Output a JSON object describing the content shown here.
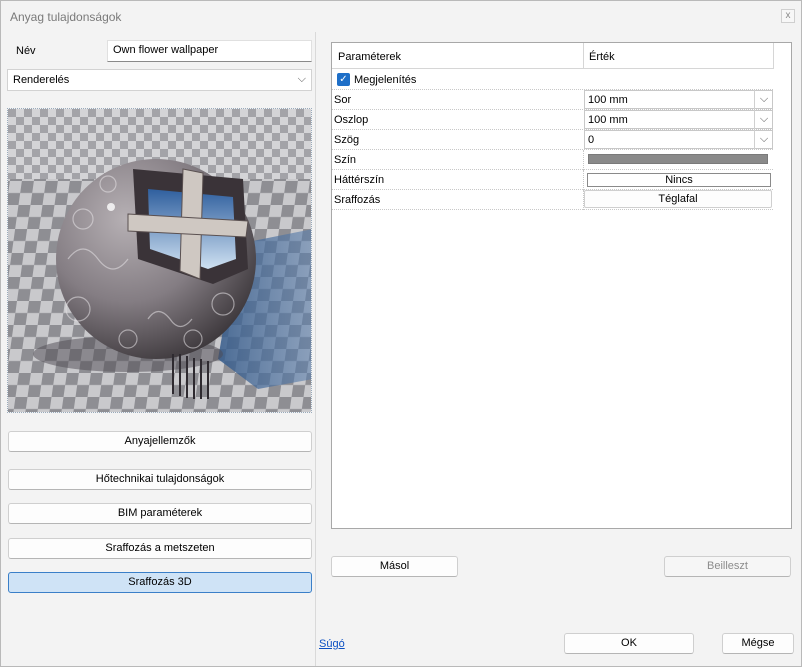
{
  "window": {
    "title": "Anyag tulajdonságok",
    "close_glyph": "x"
  },
  "left": {
    "name_label": "Név",
    "name_value": "Own flower wallpaper",
    "mode_select": "Renderelés",
    "buttons": {
      "material": "Anyajellemzők",
      "thermal": "Hőtechnikai tulajdonságok",
      "bim": "BIM paraméterek",
      "hatch_section": "Sraffozás a metszeten",
      "hatch_3d": "Sraffozás 3D"
    }
  },
  "grid": {
    "col_param": "Paraméterek",
    "col_value": "Érték",
    "group_label": "Megjelenítés",
    "rows": [
      {
        "label": "Sor",
        "value": "100 mm"
      },
      {
        "label": "Oszlop",
        "value": "100 mm"
      },
      {
        "label": "Szög",
        "value": "0"
      },
      {
        "label": "Szín",
        "value": ""
      },
      {
        "label": "Háttérszín",
        "value": "Nincs"
      },
      {
        "label": "Sraffozás",
        "value": "Téglafal"
      }
    ]
  },
  "actions": {
    "copy": "Másol",
    "paste": "Beilleszt",
    "help": "Súgó",
    "ok": "OK",
    "cancel": "Mégse"
  },
  "colors": {
    "accent": "#1e6fc8",
    "active_button": "#cfe3f6",
    "swatch": "#8a8a8a"
  }
}
